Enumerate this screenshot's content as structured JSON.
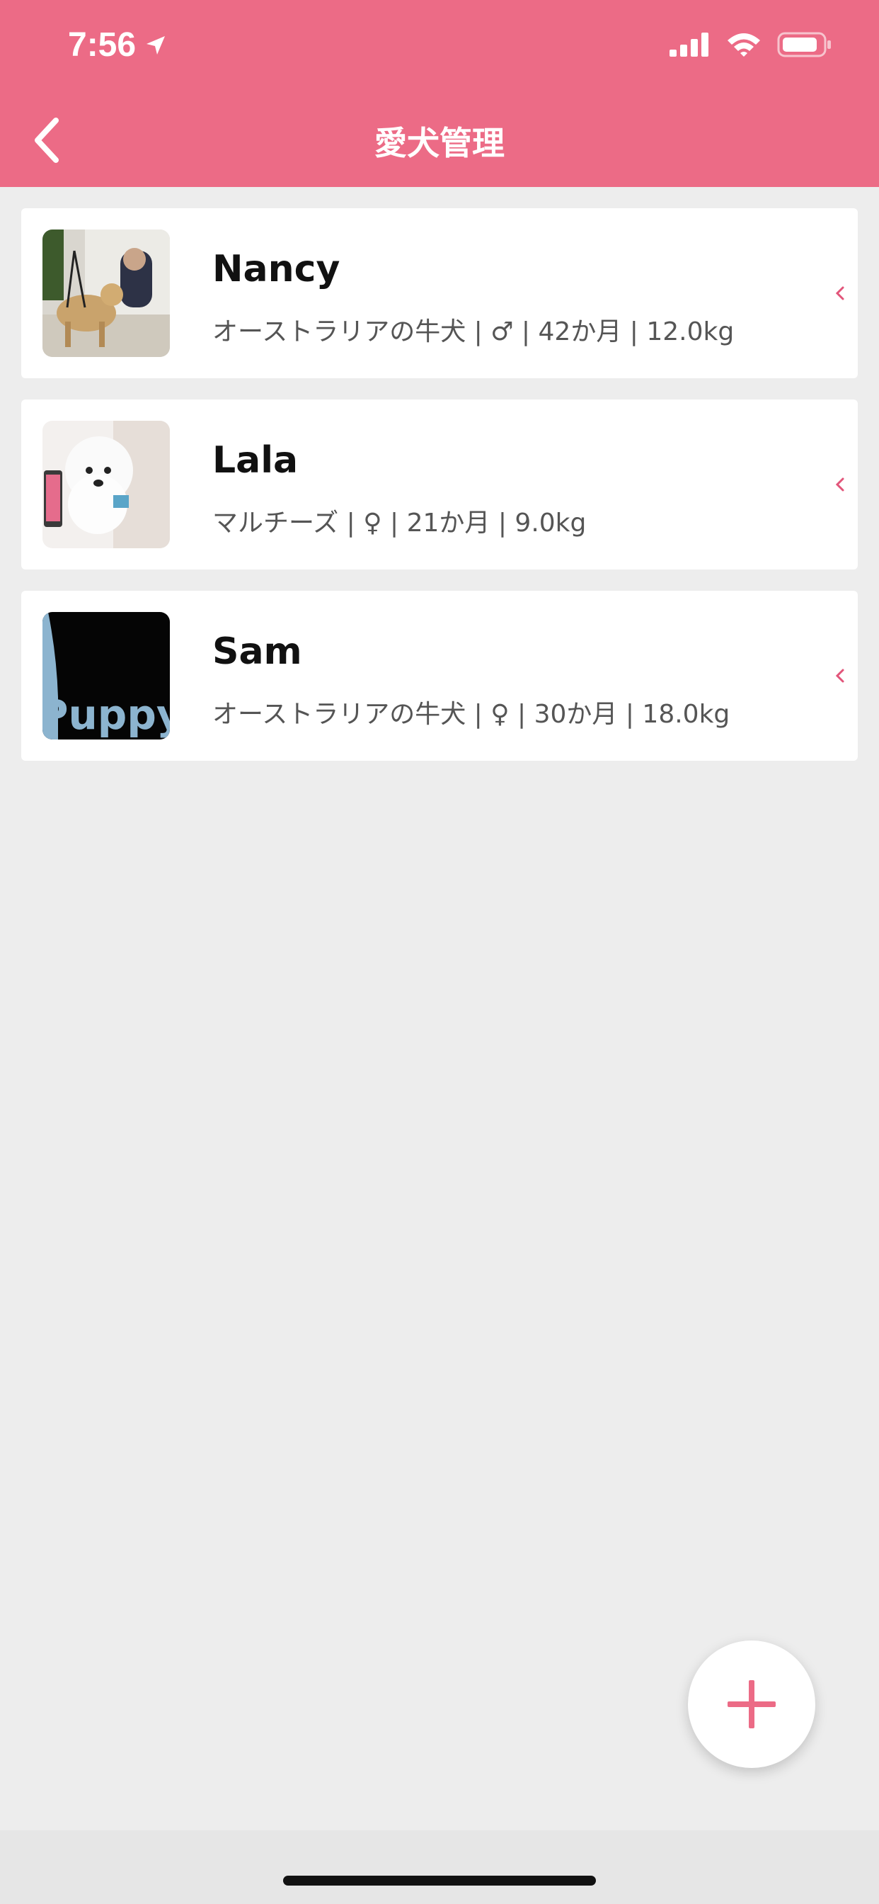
{
  "status_bar": {
    "time": "7:56"
  },
  "nav": {
    "title": "愛犬管理"
  },
  "dogs": [
    {
      "name": "Nancy",
      "info": "オーストラリアの牛犬 | ♂ | 42か月 | 12.0kg"
    },
    {
      "name": "Lala",
      "info": "マルチーズ  | ♀ | 21か月 | 9.0kg"
    },
    {
      "name": "Sam",
      "info": "オーストラリアの牛犬 | ♀ | 30か月 | 18.0kg",
      "thumb_text": "Puppy"
    }
  ],
  "colors": {
    "brand": "#ec6b86",
    "background": "#ededed"
  }
}
